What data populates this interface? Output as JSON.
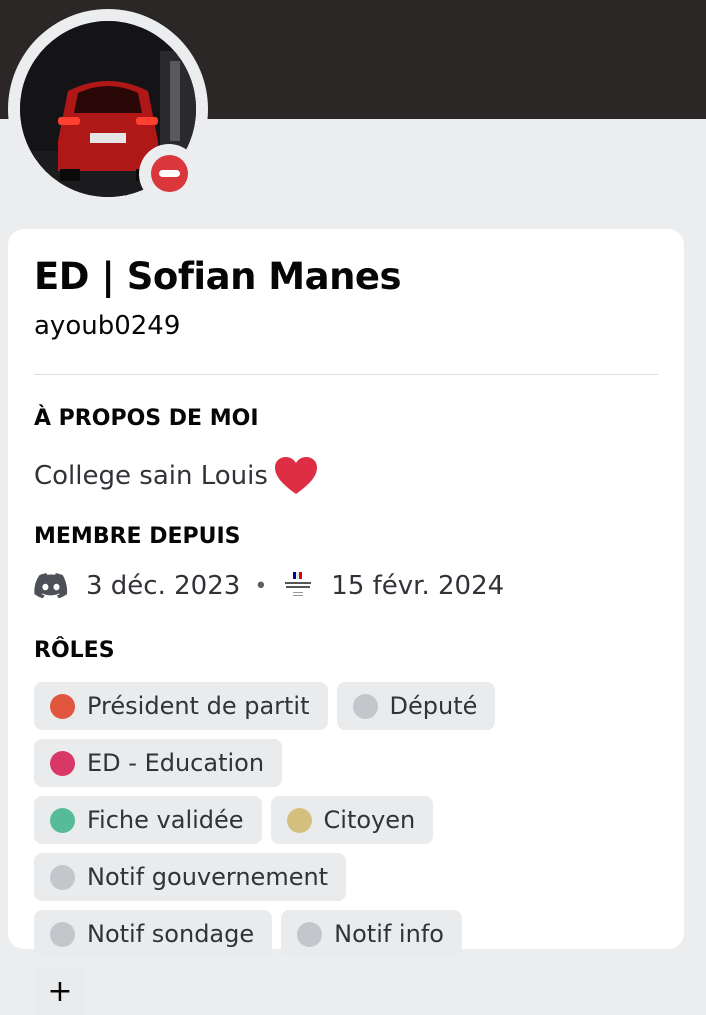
{
  "profile": {
    "display_name": "ED | Sofian Manes",
    "username": "ayoub0249",
    "status": "do-not-disturb"
  },
  "about": {
    "title": "À PROPOS DE MOI",
    "text": "College sain Louis",
    "emoji": "heart"
  },
  "member_since": {
    "title": "MEMBRE DEPUIS",
    "discord_date": "3 déc. 2023",
    "separator": "•",
    "server_date": "15 févr. 2024",
    "discord_icon": "discord-icon",
    "server_icon": "republique-francaise-icon"
  },
  "roles": {
    "title": "RÔLES",
    "items": [
      {
        "label": "Président de partit",
        "color": "#e0563f"
      },
      {
        "label": "Député",
        "color": "#c4c6cc"
      },
      {
        "label": "ED - Education",
        "color": "#d93866"
      },
      {
        "label": "Fiche validée",
        "color": "#55bb99"
      },
      {
        "label": "Citoyen",
        "color": "#d4c07e"
      },
      {
        "label": "Notif gouvernement",
        "color": "#c4c6cc"
      },
      {
        "label": "Notif sondage",
        "color": "#c4c6cc"
      },
      {
        "label": "Notif info",
        "color": "#c4c6cc"
      }
    ],
    "more_label": "+"
  },
  "colors": {
    "banner": "#2b2727",
    "status_dnd": "#da373c",
    "background": "#ebedef"
  }
}
